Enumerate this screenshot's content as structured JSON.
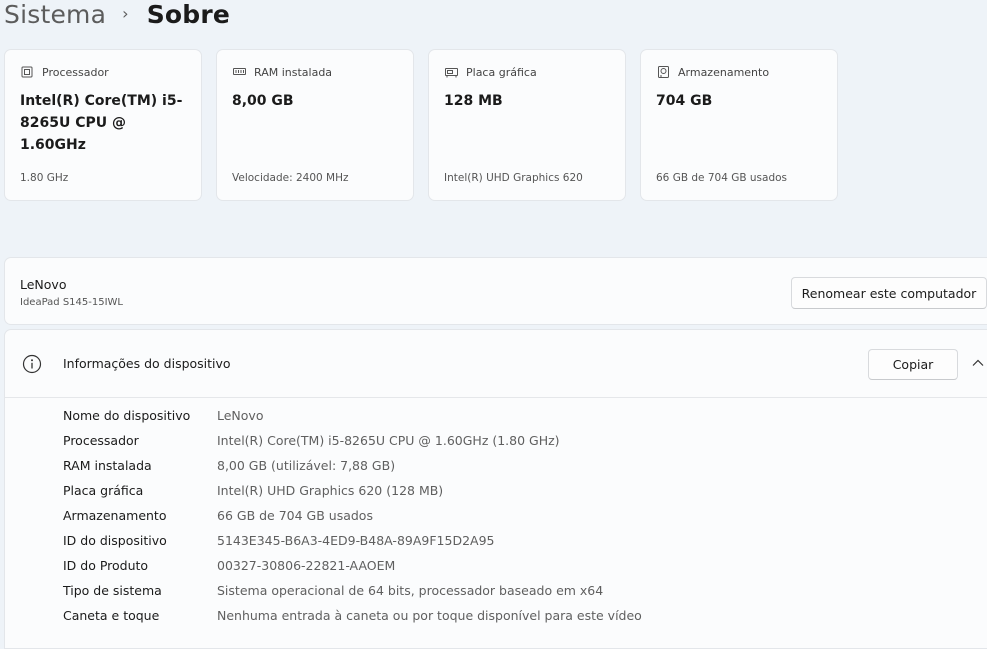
{
  "breadcrumb": {
    "parent": "Sistema",
    "separator": "›",
    "current": "Sobre"
  },
  "cards": [
    {
      "icon": "processor-icon",
      "title": "Processador",
      "value": "Intel(R) Core(TM) i5-8265U CPU @ 1.60GHz",
      "sub": "1.80 GHz"
    },
    {
      "icon": "ram-icon",
      "title": "RAM instalada",
      "value": "8,00 GB",
      "sub": "Velocidade: 2400 MHz"
    },
    {
      "icon": "graphics-card-icon",
      "title": "Placa gráfica",
      "value": "128 MB",
      "sub": "Intel(R) UHD Graphics 620"
    },
    {
      "icon": "storage-icon",
      "title": "Armazenamento",
      "value": "704 GB",
      "sub": "66 GB de 704 GB usados"
    }
  ],
  "device": {
    "name": "LeNovo",
    "model": "IdeaPad S145-15IWL",
    "rename_label": "Renomear este computador"
  },
  "info": {
    "title": "Informações do dispositivo",
    "copy_label": "Copiar",
    "rows": [
      {
        "label": "Nome do dispositivo",
        "value": "LeNovo"
      },
      {
        "label": "Processador",
        "value": "Intel(R) Core(TM) i5-8265U CPU @ 1.60GHz (1.80 GHz)"
      },
      {
        "label": "RAM instalada",
        "value": "8,00 GB (utilizável: 7,88 GB)"
      },
      {
        "label": "Placa gráfica",
        "value": "Intel(R) UHD Graphics 620 (128 MB)"
      },
      {
        "label": "Armazenamento",
        "value": "66 GB de 704 GB usados"
      },
      {
        "label": "ID do dispositivo",
        "value": "5143E345-B6A3-4ED9-B48A-89A9F15D2A95"
      },
      {
        "label": "ID do Produto",
        "value": "00327-30806-22821-AAOEM"
      },
      {
        "label": "Tipo de sistema",
        "value": "Sistema operacional de 64 bits, processador baseado em x64"
      },
      {
        "label": "Caneta e toque",
        "value": "Nenhuma entrada à caneta ou por toque disponível para este vídeo"
      }
    ]
  }
}
